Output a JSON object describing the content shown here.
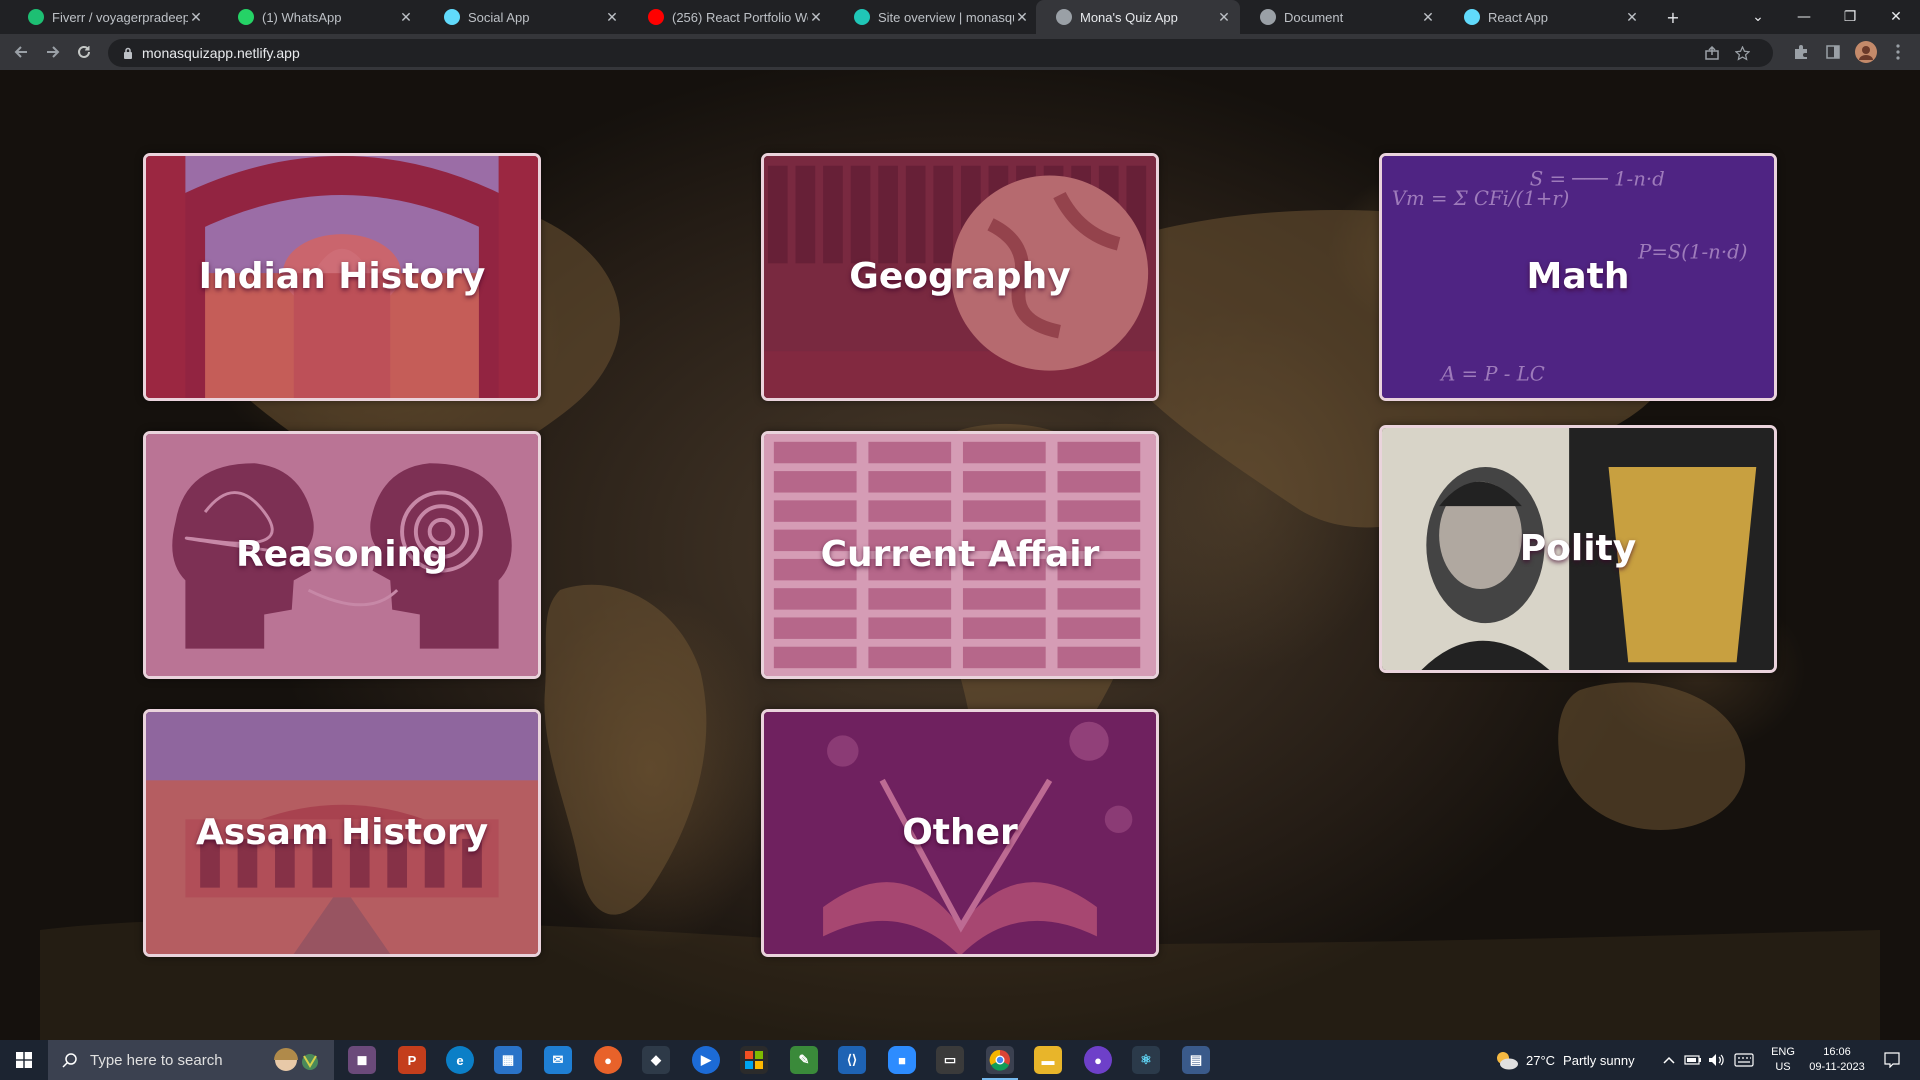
{
  "browser": {
    "tabs": [
      {
        "title": "Fiverr / voyagerpradeep /",
        "icon": "fiverr-icon",
        "color": "#1dbf73",
        "active": false
      },
      {
        "title": "(1) WhatsApp",
        "icon": "whatsapp-icon",
        "color": "#25d366",
        "active": false
      },
      {
        "title": "Social App",
        "icon": "react-icon",
        "color": "#61dafb",
        "active": false
      },
      {
        "title": "(256) React Portfolio Web",
        "icon": "youtube-icon",
        "color": "#ff0000",
        "active": false
      },
      {
        "title": "Site overview | monasqui",
        "icon": "netlify-icon",
        "color": "#20c6b7",
        "active": false
      },
      {
        "title": "Mona's Quiz App",
        "icon": "globe-icon",
        "color": "#9aa0a6",
        "active": true
      },
      {
        "title": "Document",
        "icon": "globe-icon",
        "color": "#9aa0a6",
        "active": false
      },
      {
        "title": "React App",
        "icon": "react-icon",
        "color": "#61dafb",
        "active": false
      }
    ],
    "url": "monasquizapp.netlify.app"
  },
  "page": {
    "categories": [
      {
        "label": "Indian History",
        "theme": "palace-arches",
        "tint": "#b01c6b"
      },
      {
        "label": "Geography",
        "theme": "globe-bookshelf",
        "tint": "#a0285a"
      },
      {
        "label": "Math",
        "theme": "formulas",
        "tint": "#6a1c7a"
      },
      {
        "label": "Reasoning",
        "theme": "two-heads",
        "tint": "#a8587e"
      },
      {
        "label": "Current Affair",
        "theme": "newspaper",
        "tint": "#c8709a"
      },
      {
        "label": "Polity",
        "theme": "constitution-portrait",
        "tint": "#000000"
      },
      {
        "label": "Assam History",
        "theme": "rang-ghar",
        "tint": "#a83a6a"
      },
      {
        "label": "Other",
        "theme": "open-book",
        "tint": "#8a2a66"
      }
    ]
  },
  "taskbar": {
    "search_placeholder": "Type here to search",
    "weather_temp": "27°C",
    "weather_text": "Partly sunny",
    "lang": "ENG",
    "region": "US",
    "time": "16:06",
    "date": "09-11-2023"
  }
}
